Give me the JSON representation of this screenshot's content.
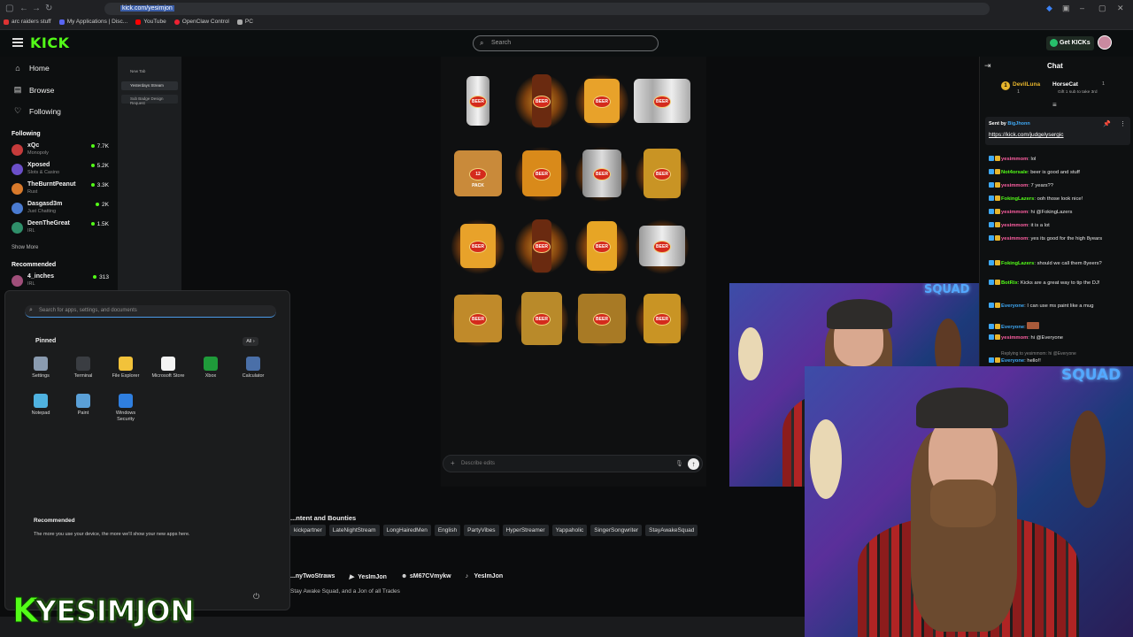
{
  "browser": {
    "url": "kick.com/yesimjon",
    "bookmarks": [
      "arc raiders stuff",
      "My Applications | Disc...",
      "YouTube",
      "OpenClaw Control",
      "PC"
    ]
  },
  "kick": {
    "logo": "KICK",
    "search_placeholder": "Search",
    "get_kicks": "Get KICKs",
    "nav": [
      {
        "label": "Home",
        "icon": "home-icon"
      },
      {
        "label": "Browse",
        "icon": "browse-icon"
      },
      {
        "label": "Following",
        "icon": "heart-icon"
      }
    ],
    "following_title": "Following",
    "following": [
      {
        "name": "xQc",
        "category": "Monopoly",
        "viewers": "7.7K",
        "color": "#c63b3b"
      },
      {
        "name": "Xposed",
        "category": "Slots & Casino",
        "viewers": "5.2K",
        "color": "#6b4fc9"
      },
      {
        "name": "TheBurntPeanut",
        "category": "Rust",
        "viewers": "3.3K",
        "color": "#d97a2b"
      },
      {
        "name": "Dasgasd3m",
        "category": "Just Chatting",
        "viewers": "2K",
        "color": "#4a7bd1"
      },
      {
        "name": "DeenTheGreat",
        "category": "IRL",
        "viewers": "1.5K",
        "color": "#2f8f6a"
      }
    ],
    "show_more": "Show More",
    "recommended_title": "Recommended",
    "recommended": [
      {
        "name": "4_inches",
        "category": "IRL",
        "viewers": "313",
        "color": "#a04f7a"
      }
    ]
  },
  "tabs": [
    "New Tab",
    "Yesterdays Stream",
    "Sub Badge Design Request"
  ],
  "ai": {
    "prompt_placeholder": "Describe edits",
    "tile_label": "BEER",
    "case_label": "12 PACK"
  },
  "start_menu": {
    "search_placeholder": "Search for apps, settings, and documents",
    "pinned_title": "Pinned",
    "all_label": "All",
    "apps": [
      {
        "label": "Settings",
        "color": "#8a9bb0"
      },
      {
        "label": "Terminal",
        "color": "#3a3d42"
      },
      {
        "label": "File Explorer",
        "color": "#f2c23a"
      },
      {
        "label": "Microsoft Store",
        "color": "#f4f4f4"
      },
      {
        "label": "Xbox",
        "color": "#1f9b3a"
      },
      {
        "label": "Calculator",
        "color": "#4a6fa8"
      },
      {
        "label": "Notepad",
        "color": "#4fb2e0"
      },
      {
        "label": "Paint",
        "color": "#5aa0d8"
      },
      {
        "label": "Windows Security",
        "color": "#2f7fe0"
      }
    ],
    "recommended_title": "Recommended",
    "recommended_text": "The more you use your device, the more we'll show your new apps here."
  },
  "about": {
    "title": "...ntent and Bounties",
    "tags": [
      "kickpartner",
      "LateNightStream",
      "LongHairedMen",
      "English",
      "PartyVibes",
      "HyperStreamer",
      "Yappaholic",
      "SingerSongwriter",
      "StayAwakeSquad"
    ],
    "socials": [
      "...nyTwoStraws",
      "YesImJon",
      "sM67CVmykw",
      "YesImJon"
    ],
    "tagline": "Stay Awake Squad, and a Jon of all Trades"
  },
  "overlay_name": "YESIMJON",
  "overlay_k": "K",
  "webcam_sign": "SQUAD",
  "chat": {
    "title": "Chat",
    "gifters": [
      {
        "name": "DevilLuna",
        "count": "1"
      },
      {
        "name": "HorseCat",
        "count": "1",
        "note": "Gift 1 sub to take 3rd"
      }
    ],
    "pinned_by": "Sent by",
    "pinned_user": "BigJhonn",
    "pinned_link": "https://kick.com/judgelysergic",
    "messages": [
      {
        "user": "yesimmom",
        "text": "lol",
        "color": "#ff5fa2"
      },
      {
        "user": "Not4orsale",
        "text": "beer is good and stuff",
        "color": "#53fc18"
      },
      {
        "user": "yesimmom",
        "text": "7 years??",
        "color": "#ff5fa2"
      },
      {
        "user": "FokingLazers",
        "text": "ooh those look nice!",
        "color": "#53fc18"
      },
      {
        "user": "yesimmom",
        "text": "hi @FokingLazers",
        "color": "#ff5fa2"
      },
      {
        "user": "yesimmom",
        "text": "it is a lot",
        "color": "#ff5fa2"
      },
      {
        "user": "yesimmom",
        "text": "yes its good for the high 8years",
        "color": "#ff5fa2"
      },
      {
        "user": "FokingLazers",
        "text": "should we call them 8yeers?",
        "color": "#53fc18"
      },
      {
        "user": "BotRix",
        "text": "Kicks are a great way to tip the DJ!",
        "color": "#53fc18"
      },
      {
        "user": "Everyone",
        "text": "I can use ms paint like a mug",
        "color": "#3fa9f5"
      },
      {
        "user": "Everyone",
        "text": "",
        "color": "#3fa9f5"
      },
      {
        "user": "yesimmom",
        "text": "hi @Everyone",
        "color": "#ff5fa2"
      },
      {
        "user": "Everyone",
        "text": "hello!!",
        "color": "#3fa9f5"
      }
    ],
    "reply_note": "Replying to yesimmom: hi @Everyone"
  }
}
